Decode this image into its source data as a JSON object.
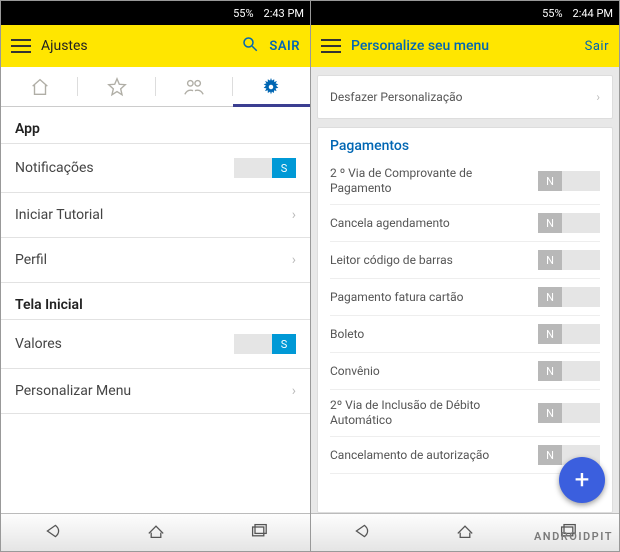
{
  "watermark": "ANDROIDPIT",
  "phone_left": {
    "status": {
      "battery": "55%",
      "time": "2:43 PM"
    },
    "topbar": {
      "title": "Ajustes",
      "action": "SAIR"
    },
    "sections": [
      {
        "header": "App",
        "rows": [
          {
            "label": "Notificações",
            "type": "toggle",
            "state": "on",
            "letter": "S"
          },
          {
            "label": "Iniciar Tutorial",
            "type": "link"
          },
          {
            "label": "Perfil",
            "type": "link"
          }
        ]
      },
      {
        "header": "Tela Inicial",
        "rows": [
          {
            "label": "Valores",
            "type": "toggle",
            "state": "on",
            "letter": "S"
          },
          {
            "label": "Personalizar Menu",
            "type": "link"
          }
        ]
      }
    ]
  },
  "phone_right": {
    "status": {
      "battery": "55%",
      "time": "2:44 PM"
    },
    "topbar": {
      "title": "Personalize seu menu",
      "action": "Sair"
    },
    "undo_label": "Desfazer Personalização",
    "category": "Pagamentos",
    "rows": [
      {
        "label": "2 º Via de Comprovante de Pagamento",
        "letter": "N"
      },
      {
        "label": "Cancela agendamento",
        "letter": "N"
      },
      {
        "label": "Leitor código de barras",
        "letter": "N"
      },
      {
        "label": "Pagamento fatura cartão",
        "letter": "N"
      },
      {
        "label": "Boleto",
        "letter": "N"
      },
      {
        "label": "Convênio",
        "letter": "N"
      },
      {
        "label": "2º Via de Inclusão de Débito Automático",
        "letter": "N"
      },
      {
        "label": "Cancelamento de autorização",
        "letter": "N"
      }
    ]
  }
}
